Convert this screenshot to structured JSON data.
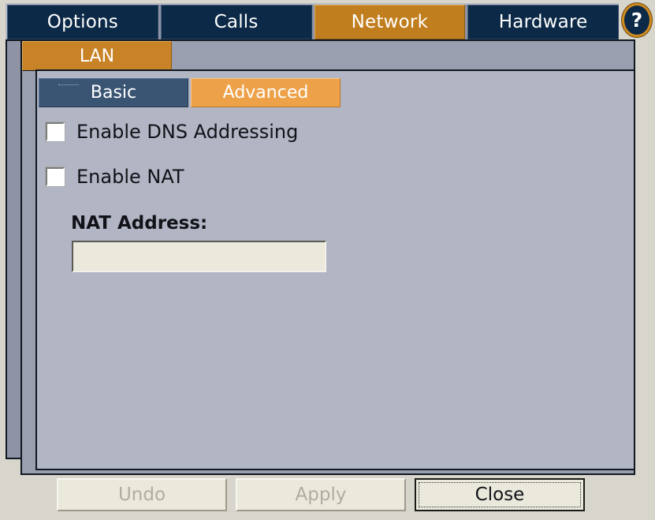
{
  "main_tabs": [
    {
      "label": "Options",
      "active": false
    },
    {
      "label": "Calls",
      "active": false
    },
    {
      "label": "Network",
      "active": true
    },
    {
      "label": "Hardware",
      "active": false
    }
  ],
  "help_button": {
    "glyph": "?",
    "name": "help-icon"
  },
  "sub_tabs": [
    {
      "label": "LAN",
      "active": true
    }
  ],
  "section_tabs": [
    {
      "label": "Basic",
      "active": false
    },
    {
      "label": "Advanced",
      "active": true
    }
  ],
  "form": {
    "checkboxes": [
      {
        "label": "Enable DNS Addressing",
        "checked": false
      },
      {
        "label": "Enable NAT",
        "checked": false
      }
    ],
    "nat_address": {
      "label": "NAT Address:",
      "value": "",
      "placeholder": ""
    }
  },
  "buttons": [
    {
      "label": "Undo",
      "enabled": false,
      "focused": false
    },
    {
      "label": "Apply",
      "enabled": false,
      "focused": false
    },
    {
      "label": "Close",
      "enabled": true,
      "focused": true
    }
  ],
  "colors": {
    "page_background": "#d8d5cc",
    "tab_inactive": "#0c2a47",
    "tab_active": "#c07e1e",
    "subtab_inactive": "#3a5574",
    "subtab_active": "#eda24a",
    "panel_back": "#8e93a6",
    "panel_mid": "#9a9fb0",
    "panel_front": "#b2b5c4",
    "field_background": "#ebe9dc",
    "button_face": "#ebe9dc",
    "accent_orange": "#d08b1f"
  }
}
